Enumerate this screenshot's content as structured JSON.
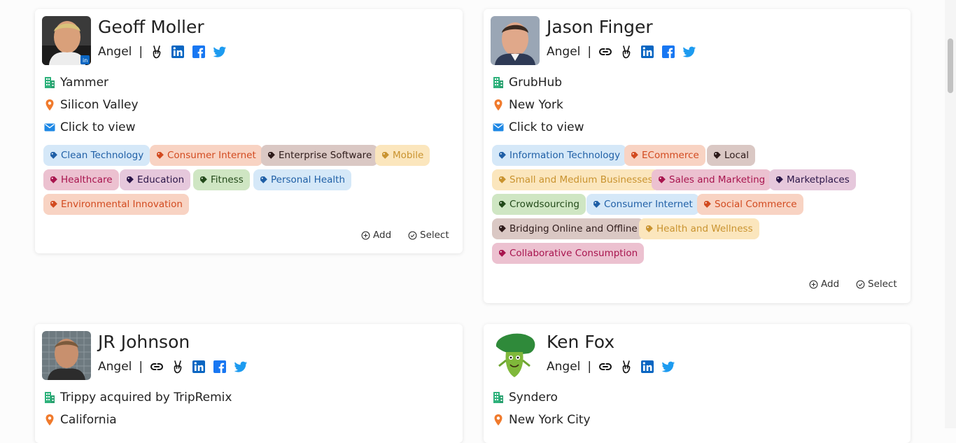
{
  "labels": {
    "role_separator": "|",
    "add": "Add",
    "select": "Select",
    "email_action": "Click to view"
  },
  "colors": {
    "building": "#2fb27c",
    "pin": "#f07a2c",
    "mail": "#1e88e5",
    "linkedin": "#0a66c2",
    "facebook": "#1877f2",
    "twitter": "#1d9bf0"
  },
  "cards": [
    {
      "name": "Geoff Moller",
      "role": "Angel",
      "social_icons": [
        "angellist-icon",
        "linkedin-icon",
        "facebook-icon",
        "twitter-icon"
      ],
      "company": "Yammer",
      "location": "Silicon Valley",
      "email": "Click to view",
      "tags": [
        {
          "label": "Clean Technology",
          "color": "blue"
        },
        {
          "label": "Consumer Internet",
          "color": "orange"
        },
        {
          "label": "Enterprise Software",
          "color": "brown"
        },
        {
          "label": "Mobile",
          "color": "yellow"
        },
        {
          "label": "Healthcare",
          "color": "pink"
        },
        {
          "label": "Education",
          "color": "purple"
        },
        {
          "label": "Fitness",
          "color": "green"
        },
        {
          "label": "Personal Health",
          "color": "blue"
        },
        {
          "label": "Environmental Innovation",
          "color": "orange"
        }
      ]
    },
    {
      "name": "Jason Finger",
      "role": "Angel",
      "social_icons": [
        "link-icon",
        "angellist-icon",
        "linkedin-icon",
        "facebook-icon",
        "twitter-icon"
      ],
      "company": "GrubHub",
      "location": "New York",
      "email": "Click to view",
      "tags": [
        {
          "label": "Information Technology",
          "color": "blue"
        },
        {
          "label": "ECommerce",
          "color": "orange"
        },
        {
          "label": "Local",
          "color": "brown"
        },
        {
          "label": "Small and Medium Businesses",
          "color": "yellow"
        },
        {
          "label": "Sales and Marketing",
          "color": "pink"
        },
        {
          "label": "Marketplaces",
          "color": "purple"
        },
        {
          "label": "Crowdsourcing",
          "color": "green"
        },
        {
          "label": "Consumer Internet",
          "color": "blue"
        },
        {
          "label": "Social Commerce",
          "color": "orange"
        },
        {
          "label": "Bridging Online and Offline",
          "color": "brown"
        },
        {
          "label": "Health and Wellness",
          "color": "yellow"
        },
        {
          "label": "Collaborative Consumption",
          "color": "pink"
        }
      ]
    },
    {
      "name": "JR Johnson",
      "role": "Angel",
      "social_icons": [
        "link-icon",
        "angellist-icon",
        "linkedin-icon",
        "facebook-icon",
        "twitter-icon"
      ],
      "company": "Trippy acquired by TripRemix",
      "location": "California"
    },
    {
      "name": "Ken Fox",
      "role": "Angel",
      "social_icons": [
        "link-icon",
        "angellist-icon",
        "linkedin-icon",
        "twitter-icon"
      ],
      "company": "Syndero",
      "location": "New York City"
    }
  ]
}
